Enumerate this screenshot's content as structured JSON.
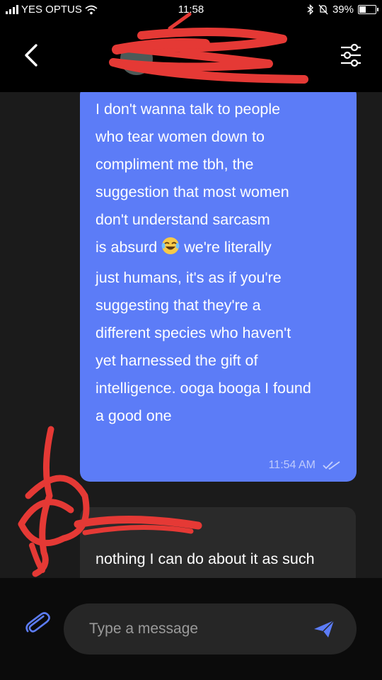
{
  "status_bar": {
    "carrier": "YES OPTUS",
    "time": "11:58",
    "battery": "39%",
    "battery_level": 0.39
  },
  "header": {
    "contact_name": "",
    "icons": {
      "back": "back-arrow-icon",
      "settings": "sliders-icon"
    }
  },
  "messages": [
    {
      "direction": "outgoing",
      "text": "I don't wanna talk to people\nwho tear women down to\ncompliment me tbh, the\nsuggestion that most women\ndon't understand sarcasm\nis absurd",
      "emoji": "😂",
      "text_after_emoji": " we're literally\njust humans, it's as if you're\nsuggesting that they're a\ndifferent species who haven't\nyet harnessed the gift of\nintelligence. ooga booga I found\na good one",
      "time": "11:54 AM",
      "status": "read"
    },
    {
      "direction": "incoming",
      "sender": "",
      "text": "nothing I can do about it as such"
    }
  ],
  "composer": {
    "placeholder": "Type a message",
    "icons": {
      "attach": "paperclip-icon",
      "send": "send-icon"
    }
  },
  "colors": {
    "outgoing_bubble": "#5c7cf7",
    "incoming_bubble": "#2a2a2a",
    "chat_background": "#1b1b1b",
    "redaction": "#e53935"
  }
}
